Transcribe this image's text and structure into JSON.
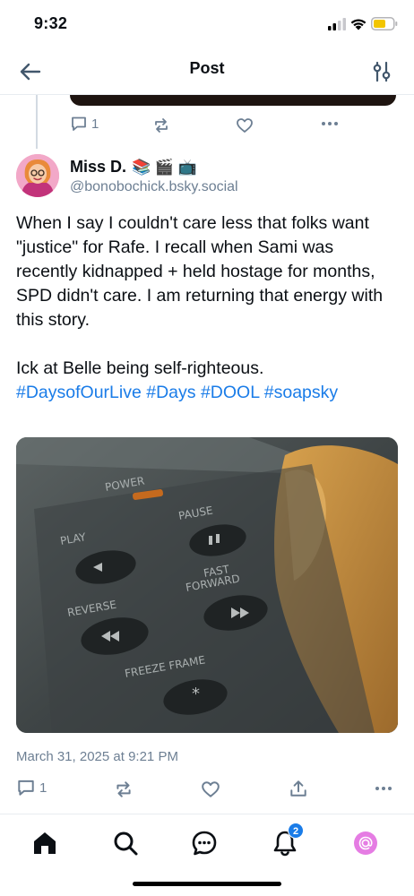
{
  "status_bar": {
    "time": "9:32"
  },
  "header": {
    "title": "Post"
  },
  "previous_post": {
    "reply_count": "1"
  },
  "post": {
    "author_name": "Miss D.",
    "author_emoji": "📚 🎬 📺",
    "author_handle": "@bonobochick.bsky.social",
    "text_line_1": "When I say I couldn't care less that folks want \"justice\" for Rafe. I recall when Sami was recently kidnapped + held hostage for months, SPD didn't care. I am returning that energy with this story.",
    "text_line_2": "Ick at Belle being self-righteous.",
    "hashtags": [
      "#DaysofOurLive",
      "#Days",
      "#DOOL",
      "#soapsky"
    ],
    "timestamp": "March 31, 2025 at 9:21 PM",
    "reply_count": "1",
    "media": {
      "power_label": "POWER",
      "play_label": "PLAY",
      "pause_label": "PAUSE",
      "fast_label": "FAST",
      "forward_label": "FORWARD",
      "reverse_label": "REVERSE",
      "freeze_label": "FREEZE FRAME"
    }
  },
  "tab_bar": {
    "notifications_badge": "2"
  },
  "colors": {
    "accent": "#1a7ce8",
    "muted": "#6d7f93",
    "mention_pink": "#e57ce3"
  }
}
